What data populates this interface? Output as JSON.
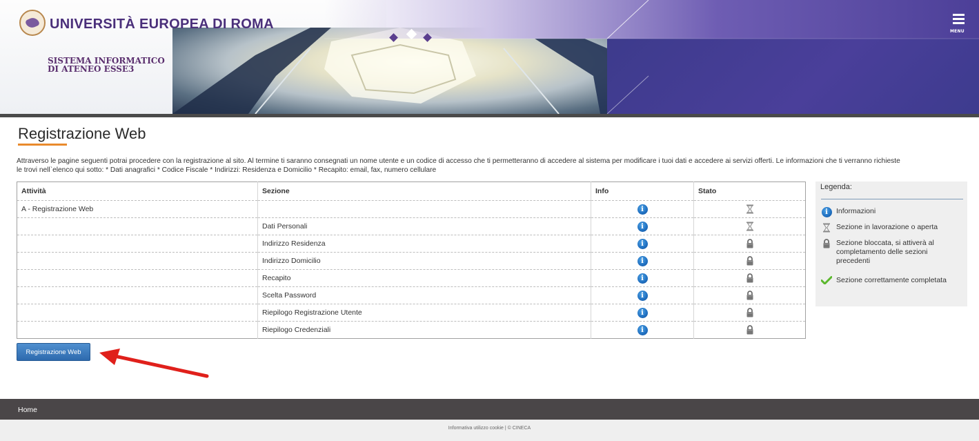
{
  "header": {
    "university_name": "UNIVERSITÀ EUROPEA DI ROMA",
    "system_line1": "SISTEMA INFORMATICO",
    "system_line2": "DI ATENEO ESSE3",
    "menu_label": "MENU",
    "colors": {
      "primary": "#3d3b8e",
      "accent": "#e98a2c"
    }
  },
  "main": {
    "title": "Registrazione Web",
    "intro_line1": "Attraverso le pagine seguenti potrai procedere con la registrazione al sito. Al termine ti saranno consegnati un nome utente e un codice di accesso che ti permetteranno di accedere al sistema per modificare i tuoi dati e accedere ai servizi offerti. Le informazioni che ti verranno richieste",
    "intro_line2": "le trovi nell`elenco qui sotto: * Dati anagrafici * Codice Fiscale * Indirizzi: Residenza e Domicilio * Recapito: email, fax, numero cellulare",
    "table": {
      "headers": {
        "activity": "Attività",
        "section": "Sezione",
        "info": "Info",
        "status": "Stato"
      },
      "rows": [
        {
          "activity": "A - Registrazione Web",
          "section": "",
          "info_icon": "info-icon",
          "status_icon": "hourglass-icon"
        },
        {
          "activity": "",
          "section": "Dati Personali",
          "info_icon": "info-icon",
          "status_icon": "hourglass-icon"
        },
        {
          "activity": "",
          "section": "Indirizzo Residenza",
          "info_icon": "info-icon",
          "status_icon": "lock-icon"
        },
        {
          "activity": "",
          "section": "Indirizzo Domicilio",
          "info_icon": "info-icon",
          "status_icon": "lock-icon"
        },
        {
          "activity": "",
          "section": "Recapito",
          "info_icon": "info-icon",
          "status_icon": "lock-icon"
        },
        {
          "activity": "",
          "section": "Scelta Password",
          "info_icon": "info-icon",
          "status_icon": "lock-icon"
        },
        {
          "activity": "",
          "section": "Riepilogo Registrazione Utente",
          "info_icon": "info-icon",
          "status_icon": "lock-icon"
        },
        {
          "activity": "",
          "section": "Riepilogo Credenziali",
          "info_icon": "info-icon",
          "status_icon": "lock-icon"
        }
      ]
    },
    "legend": {
      "title": "Legenda:",
      "items": [
        {
          "icon": "info-icon",
          "text": "Informazioni"
        },
        {
          "icon": "hourglass-icon",
          "text": "Sezione in lavorazione o aperta"
        },
        {
          "icon": "lock-icon",
          "text": "Sezione bloccata, si attiverà al completamento delle sezioni precedenti"
        },
        {
          "icon": "check-icon",
          "text": "Sezione correttamente completata"
        }
      ]
    },
    "register_button": "Registrazione Web",
    "arrow_color": "#e0201b"
  },
  "footer": {
    "home_label": "Home",
    "bottom_text": "Informativa utilizzo cookie | © CINECA"
  }
}
